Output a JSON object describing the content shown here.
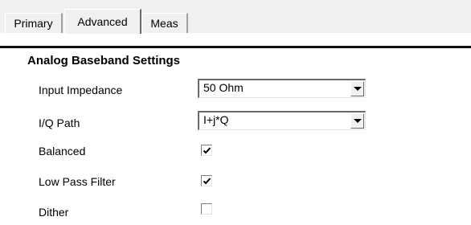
{
  "tabs": [
    {
      "label": "Primary",
      "active": false
    },
    {
      "label": "Advanced",
      "active": true
    },
    {
      "label": "Meas",
      "active": false
    }
  ],
  "section": {
    "title": "Analog Baseband Settings"
  },
  "fields": {
    "input_impedance": {
      "label": "Input Impedance",
      "value": "50 Ohm"
    },
    "iq_path": {
      "label": "I/Q Path",
      "value": "I+j*Q"
    },
    "balanced": {
      "label": "Balanced",
      "checked": true
    },
    "low_pass_filter": {
      "label": "Low Pass Filter",
      "checked": true
    },
    "dither": {
      "label": "Dither",
      "checked": false
    }
  },
  "icons": {
    "dropdown": "chevron-down-icon",
    "check": "checkmark-icon"
  }
}
